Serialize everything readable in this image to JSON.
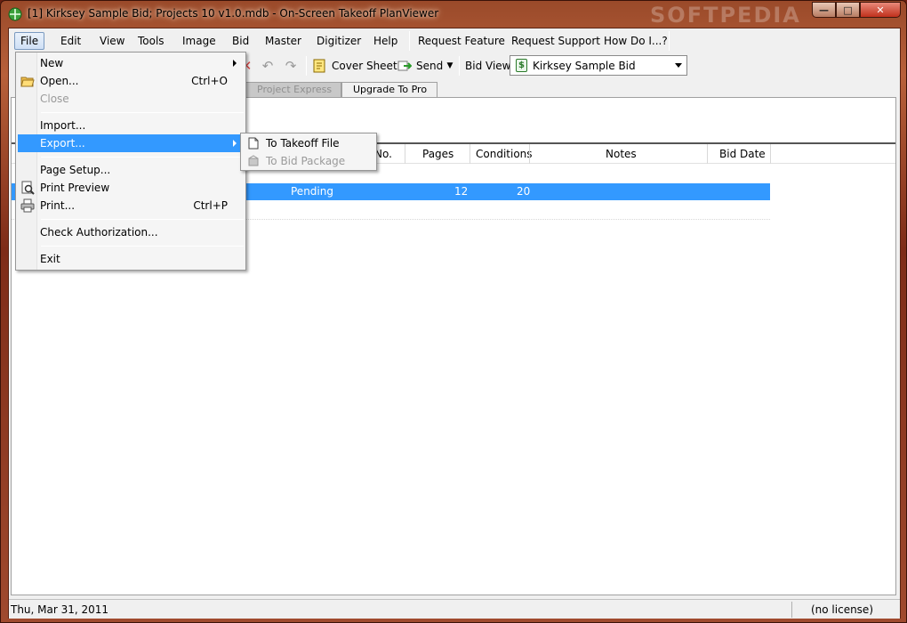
{
  "window": {
    "title": "[1] Kirksey Sample Bid; Projects 10 v1.0.mdb - On-Screen Takeoff PlanViewer",
    "watermark": "SOFTPEDIA",
    "controls": {
      "minimize": "—",
      "maximize": "□",
      "close": "✕"
    }
  },
  "menubar": {
    "items": [
      "File",
      "Edit",
      "View",
      "Tools",
      "Image",
      "Bid",
      "Master",
      "Digitizer",
      "Help"
    ],
    "extras": [
      "Request Feature",
      "Request Support",
      "How Do I...?"
    ],
    "active": "File"
  },
  "toolbar": {
    "cover_sheet": "Cover Sheet",
    "send": "Send",
    "bid_view_label": "Bid View",
    "bid_select_value": "Kirksey Sample Bid",
    "icons": [
      "delete-icon",
      "undo-icon",
      "redo-icon",
      "cover-sheet-icon",
      "send-icon",
      "bid-icon"
    ]
  },
  "tabs": {
    "project_express": "Project Express",
    "upgrade": "Upgrade To Pro"
  },
  "grid": {
    "columns": [
      "No.",
      "Pages",
      "Conditions",
      "Notes",
      "Bid Date"
    ],
    "selected_row": {
      "status": "Pending",
      "pages": "12",
      "conditions": "20"
    }
  },
  "file_menu": {
    "items": [
      {
        "label": "New",
        "icon": "",
        "shortcut": "",
        "submenu": true,
        "disabled": false
      },
      {
        "label": "Open...",
        "icon": "open-folder-icon",
        "shortcut": "Ctrl+O",
        "submenu": false,
        "disabled": false
      },
      {
        "label": "Close",
        "icon": "",
        "shortcut": "",
        "submenu": false,
        "disabled": true
      },
      {
        "label": "Import...",
        "icon": "",
        "shortcut": "",
        "submenu": false,
        "disabled": false
      },
      {
        "label": "Export...",
        "icon": "",
        "shortcut": "",
        "submenu": true,
        "disabled": false
      },
      {
        "label": "Page Setup...",
        "icon": "",
        "shortcut": "",
        "submenu": false,
        "disabled": false
      },
      {
        "label": "Print Preview",
        "icon": "print-preview-icon",
        "shortcut": "",
        "submenu": false,
        "disabled": false
      },
      {
        "label": "Print...",
        "icon": "printer-icon",
        "shortcut": "Ctrl+P",
        "submenu": false,
        "disabled": false
      },
      {
        "label": "Check Authorization...",
        "icon": "",
        "shortcut": "",
        "submenu": false,
        "disabled": false
      },
      {
        "label": "Exit",
        "icon": "",
        "shortcut": "",
        "submenu": false,
        "disabled": false
      }
    ]
  },
  "export_submenu": {
    "items": [
      {
        "label": "To Takeoff File",
        "icon": "document-icon",
        "disabled": false
      },
      {
        "label": "To Bid Package",
        "icon": "package-icon",
        "disabled": true
      }
    ]
  },
  "statusbar": {
    "date": "Thu, Mar 31, 2011",
    "license": "(no license)"
  },
  "colors": {
    "selection": "#3399ff",
    "menu_hover": "#3399ff"
  }
}
